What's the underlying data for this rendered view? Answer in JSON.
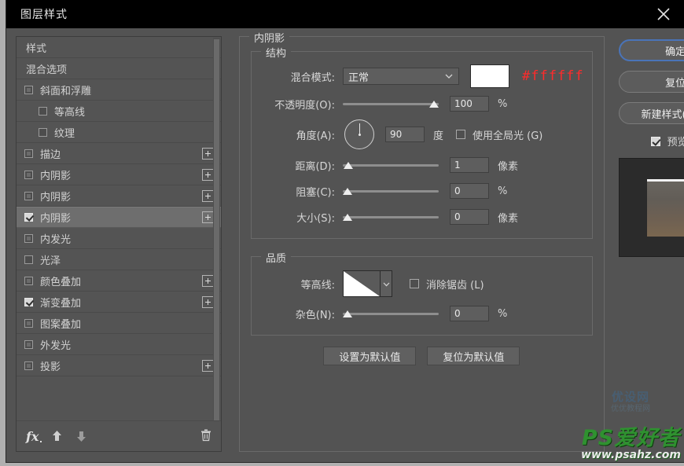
{
  "window": {
    "title": "图层样式",
    "close_icon": "close-icon"
  },
  "style_list": {
    "items": [
      {
        "label": "样式",
        "type": "header",
        "checkbox": false,
        "checked": false,
        "plus": false,
        "indent": false,
        "selected": false
      },
      {
        "label": "混合选项",
        "type": "header",
        "checkbox": false,
        "checked": false,
        "plus": false,
        "indent": false,
        "selected": false
      },
      {
        "label": "斜面和浮雕",
        "type": "effect",
        "checkbox": true,
        "checked": false,
        "plus": false,
        "indent": false,
        "selected": false
      },
      {
        "label": "等高线",
        "type": "effect",
        "checkbox": true,
        "checked": false,
        "plus": false,
        "indent": true,
        "selected": false
      },
      {
        "label": "纹理",
        "type": "effect",
        "checkbox": true,
        "checked": false,
        "plus": false,
        "indent": true,
        "selected": false
      },
      {
        "label": "描边",
        "type": "effect",
        "checkbox": true,
        "checked": false,
        "plus": true,
        "indent": false,
        "selected": false
      },
      {
        "label": "内阴影",
        "type": "effect",
        "checkbox": true,
        "checked": false,
        "plus": true,
        "indent": false,
        "selected": false
      },
      {
        "label": "内阴影",
        "type": "effect",
        "checkbox": true,
        "checked": false,
        "plus": true,
        "indent": false,
        "selected": false
      },
      {
        "label": "内阴影",
        "type": "effect",
        "checkbox": true,
        "checked": true,
        "plus": true,
        "indent": false,
        "selected": true
      },
      {
        "label": "内发光",
        "type": "effect",
        "checkbox": true,
        "checked": false,
        "plus": false,
        "indent": false,
        "selected": false
      },
      {
        "label": "光泽",
        "type": "effect",
        "checkbox": true,
        "checked": false,
        "plus": false,
        "indent": false,
        "selected": false
      },
      {
        "label": "颜色叠加",
        "type": "effect",
        "checkbox": true,
        "checked": false,
        "plus": true,
        "indent": false,
        "selected": false
      },
      {
        "label": "渐变叠加",
        "type": "effect",
        "checkbox": true,
        "checked": true,
        "plus": true,
        "indent": false,
        "selected": false
      },
      {
        "label": "图案叠加",
        "type": "effect",
        "checkbox": true,
        "checked": false,
        "plus": false,
        "indent": false,
        "selected": false
      },
      {
        "label": "外发光",
        "type": "effect",
        "checkbox": true,
        "checked": false,
        "plus": false,
        "indent": false,
        "selected": false
      },
      {
        "label": "投影",
        "type": "effect",
        "checkbox": true,
        "checked": false,
        "plus": true,
        "indent": false,
        "selected": false
      }
    ],
    "footer": {
      "fx_label": "fx",
      "up_icon": "arrow-up-icon",
      "down_icon": "arrow-down-icon",
      "delete_icon": "trash-icon"
    }
  },
  "panel": {
    "title": "内阴影",
    "structure": {
      "legend": "结构",
      "blend_mode": {
        "label": "混合模式:",
        "value": "正常",
        "color_hex": "#ffffff",
        "annotation": "#ffffff"
      },
      "opacity": {
        "label": "不透明度(O):",
        "value": "100",
        "unit": "%",
        "slider_pct": 100
      },
      "angle": {
        "label": "角度(A):",
        "value": "90",
        "unit": "度",
        "global_light_label": "使用全局光 (G)",
        "global_light_checked": false
      },
      "distance": {
        "label": "距离(D):",
        "value": "1",
        "unit": "像素",
        "slider_pct": 2
      },
      "choke": {
        "label": "阻塞(C):",
        "value": "0",
        "unit": "%",
        "slider_pct": 0
      },
      "size": {
        "label": "大小(S):",
        "value": "0",
        "unit": "像素",
        "slider_pct": 0
      }
    },
    "quality": {
      "legend": "品质",
      "contour": {
        "label": "等高线:",
        "anti_alias_label": "消除锯齿 (L)",
        "anti_alias_checked": false
      },
      "noise": {
        "label": "杂色(N):",
        "value": "0",
        "unit": "%",
        "slider_pct": 0
      }
    },
    "buttons": {
      "set_default": "设置为默认值",
      "reset_default": "复位为默认值"
    }
  },
  "right": {
    "ok": "确定",
    "reset": "复位",
    "new_style": "新建样式(W)...",
    "preview_label": "预览(V)",
    "preview_checked": true
  },
  "watermarks": {
    "blue_main": "优设网",
    "blue_sub": "优优教程网",
    "green_main": "PS爱好者",
    "green_url": "www.psahz.com"
  },
  "colors": {
    "accent": "#4a74b8",
    "annotation_red": "#ff2b2b",
    "panel_bg": "#535353",
    "titlebar_bg": "#000000"
  }
}
